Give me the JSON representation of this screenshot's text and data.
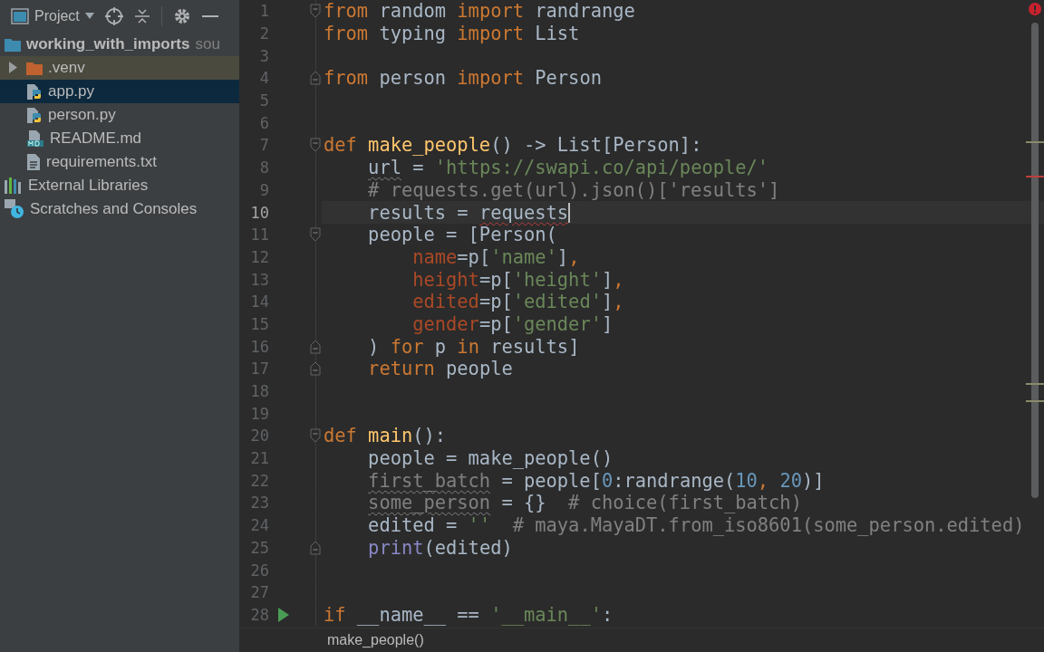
{
  "sidebar": {
    "title": "Project",
    "tree": [
      {
        "label": "working_with_imports",
        "hint": "sou",
        "kind": "folder",
        "selected": false,
        "children": [
          {
            "label": ".venv",
            "kind": "excluded-folder",
            "expanded": false,
            "selected": false
          },
          {
            "label": "app.py",
            "kind": "python",
            "selected": true
          },
          {
            "label": "person.py",
            "kind": "python",
            "selected": false
          },
          {
            "label": "README.md",
            "kind": "markdown",
            "selected": false
          },
          {
            "label": "requirements.txt",
            "kind": "text",
            "selected": false
          }
        ]
      },
      {
        "label": "External Libraries",
        "kind": "libraries",
        "selected": false
      },
      {
        "label": "Scratches and Consoles",
        "kind": "scratches",
        "selected": false
      }
    ]
  },
  "editor": {
    "lines": [
      {
        "number": "1",
        "fold_start": true,
        "current": false,
        "tokens": [
          {
            "kind": "kw",
            "text": "from"
          },
          {
            "kind": "plain",
            "text": " random "
          },
          {
            "kind": "kw",
            "text": "import"
          },
          {
            "kind": "plain",
            "text": " randrange"
          }
        ]
      },
      {
        "number": "2",
        "current": false,
        "tokens": [
          {
            "kind": "kw",
            "text": "from"
          },
          {
            "kind": "plain",
            "text": " typing "
          },
          {
            "kind": "kw",
            "text": "import"
          },
          {
            "kind": "plain",
            "text": " List"
          }
        ]
      },
      {
        "number": "3",
        "current": false
      },
      {
        "number": "4",
        "fold_end": true,
        "current": false,
        "tokens": [
          {
            "kind": "kw",
            "text": "from"
          },
          {
            "kind": "plain",
            "text": " person "
          },
          {
            "kind": "kw",
            "text": "import"
          },
          {
            "kind": "plain",
            "text": " Person"
          }
        ]
      },
      {
        "number": "5",
        "current": false
      },
      {
        "number": "6",
        "current": false
      },
      {
        "number": "7",
        "fold_start": true,
        "current": false,
        "tokens": [
          {
            "kind": "kw",
            "text": "def "
          },
          {
            "kind": "fn",
            "text": "make_people"
          },
          {
            "kind": "plain",
            "text": "() -> List[Person]:"
          }
        ]
      },
      {
        "number": "8",
        "current": false,
        "tokens": [
          {
            "kind": "warn",
            "text": "    url"
          },
          {
            "kind": "plain",
            "text": " = "
          },
          {
            "kind": "str",
            "text": "'https://swapi.co/api/people/'"
          }
        ]
      },
      {
        "number": "9",
        "current": false,
        "tokens": [
          {
            "kind": "comment",
            "text": "    # requests.get(url).json()['results']"
          }
        ]
      },
      {
        "number": "10",
        "current": true,
        "tokens": [
          {
            "kind": "plain",
            "text": "    results = "
          },
          {
            "kind": "error",
            "text": "requests"
          }
        ]
      },
      {
        "number": "11",
        "fold_start": true,
        "current": false,
        "tokens": [
          {
            "kind": "plain",
            "text": "    people = [Person("
          }
        ]
      },
      {
        "number": "12",
        "current": false,
        "tokens": [
          {
            "kind": "param",
            "text": "        name"
          },
          {
            "kind": "plain",
            "text": "=p["
          },
          {
            "kind": "str",
            "text": "'name'"
          },
          {
            "kind": "plain",
            "text": "]"
          },
          {
            "kind": "punct",
            "text": ","
          }
        ]
      },
      {
        "number": "13",
        "current": false,
        "tokens": [
          {
            "kind": "param",
            "text": "        height"
          },
          {
            "kind": "plain",
            "text": "=p["
          },
          {
            "kind": "str",
            "text": "'height'"
          },
          {
            "kind": "plain",
            "text": "]"
          },
          {
            "kind": "punct",
            "text": ","
          }
        ]
      },
      {
        "number": "14",
        "current": false,
        "tokens": [
          {
            "kind": "param",
            "text": "        edited"
          },
          {
            "kind": "plain",
            "text": "=p["
          },
          {
            "kind": "str",
            "text": "'edited'"
          },
          {
            "kind": "plain",
            "text": "]"
          },
          {
            "kind": "punct",
            "text": ","
          }
        ]
      },
      {
        "number": "15",
        "current": false,
        "tokens": [
          {
            "kind": "param",
            "text": "        gender"
          },
          {
            "kind": "plain",
            "text": "=p["
          },
          {
            "kind": "str",
            "text": "'gender'"
          },
          {
            "kind": "plain",
            "text": "]"
          }
        ]
      },
      {
        "number": "16",
        "fold_end": true,
        "current": false,
        "tokens": [
          {
            "kind": "plain",
            "text": "    ) "
          },
          {
            "kind": "kw",
            "text": "for"
          },
          {
            "kind": "plain",
            "text": " p "
          },
          {
            "kind": "kw",
            "text": "in"
          },
          {
            "kind": "plain",
            "text": " results]"
          }
        ]
      },
      {
        "number": "17",
        "fold_end": true,
        "current": false,
        "tokens": [
          {
            "kind": "kw",
            "text": "    return"
          },
          {
            "kind": "plain",
            "text": " people"
          }
        ]
      },
      {
        "number": "18",
        "current": false
      },
      {
        "number": "19",
        "current": false
      },
      {
        "number": "20",
        "fold_start": true,
        "current": false,
        "tokens": [
          {
            "kind": "kw",
            "text": "def "
          },
          {
            "kind": "fn",
            "text": "main"
          },
          {
            "kind": "plain",
            "text": "():"
          }
        ]
      },
      {
        "number": "21",
        "current": false,
        "tokens": [
          {
            "kind": "plain",
            "text": "    people = make_people()"
          }
        ]
      },
      {
        "number": "22",
        "current": false,
        "tokens": [
          {
            "kind": "unused",
            "text": "    first_batch"
          },
          {
            "kind": "plain",
            "text": " = people["
          },
          {
            "kind": "num",
            "text": "0"
          },
          {
            "kind": "plain",
            "text": ":randrange("
          },
          {
            "kind": "num",
            "text": "10"
          },
          {
            "kind": "punct",
            "text": ", "
          },
          {
            "kind": "num",
            "text": "20"
          },
          {
            "kind": "plain",
            "text": ")]"
          }
        ]
      },
      {
        "number": "23",
        "current": false,
        "tokens": [
          {
            "kind": "unused",
            "text": "    some_person"
          },
          {
            "kind": "plain",
            "text": " = {}  "
          },
          {
            "kind": "comment",
            "text": "# choice(first_batch)"
          }
        ]
      },
      {
        "number": "24",
        "current": false,
        "tokens": [
          {
            "kind": "plain",
            "text": "    edited = "
          },
          {
            "kind": "str",
            "text": "''"
          },
          {
            "kind": "comment",
            "text": "  # maya.MayaDT.from_iso8601(some_person.edited)"
          }
        ]
      },
      {
        "number": "25",
        "fold_end": true,
        "current": false,
        "tokens": [
          {
            "kind": "builtin",
            "text": "    print"
          },
          {
            "kind": "plain",
            "text": "(edited)"
          }
        ]
      },
      {
        "number": "26",
        "current": false
      },
      {
        "number": "27",
        "current": false
      },
      {
        "number": "28",
        "run": true,
        "current": false,
        "tokens": [
          {
            "kind": "kw",
            "text": "if"
          },
          {
            "kind": "plain",
            "text": " __name__ == "
          },
          {
            "kind": "str",
            "text": "'__main__'"
          },
          {
            "kind": "plain",
            "text": ":"
          }
        ]
      }
    ]
  },
  "breadcrumb": "make_people()"
}
